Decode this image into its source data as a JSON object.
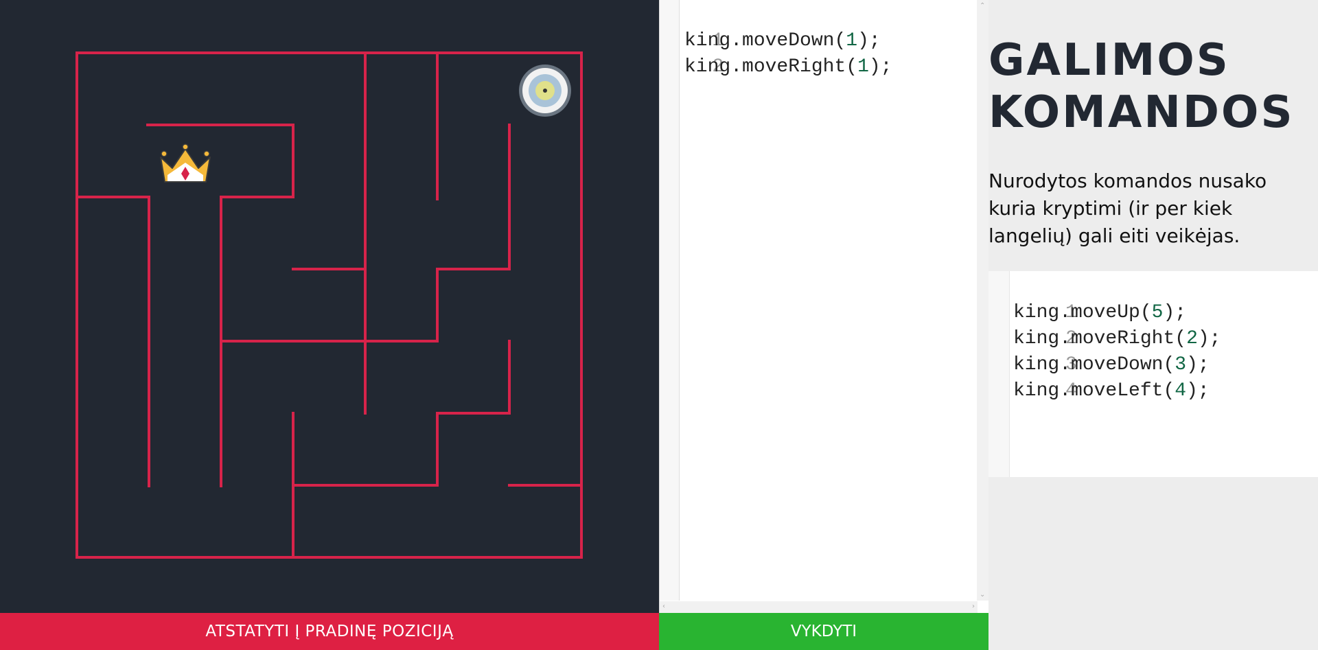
{
  "maze": {
    "wall_color": "#d7234a",
    "background": "#222832",
    "player_icon": "crown-icon",
    "goal_icon": "target-icon"
  },
  "buttons": {
    "reset_label": "ATSTATYTI Į PRADINĘ POZICIJĄ",
    "run_label": "VYKDYTI"
  },
  "editor": {
    "lines": [
      {
        "num": "1",
        "fn": "king.moveDown",
        "arg": "1"
      },
      {
        "num": "2",
        "fn": "king.moveRight",
        "arg": "1"
      }
    ]
  },
  "commands": {
    "title_line1": "GALIMOS",
    "title_line2": "KOMANDOS",
    "description": "Nurodytos komandos nusako kuria kryptimi (ir per kiek langelių) gali eiti veikėjas.",
    "examples": [
      {
        "num": "1",
        "fn": "king.moveUp",
        "arg": "5"
      },
      {
        "num": "2",
        "fn": "king.moveRight",
        "arg": "2"
      },
      {
        "num": "3",
        "fn": "king.moveDown",
        "arg": "3"
      },
      {
        "num": "4",
        "fn": "king.moveLeft",
        "arg": "4"
      }
    ]
  }
}
